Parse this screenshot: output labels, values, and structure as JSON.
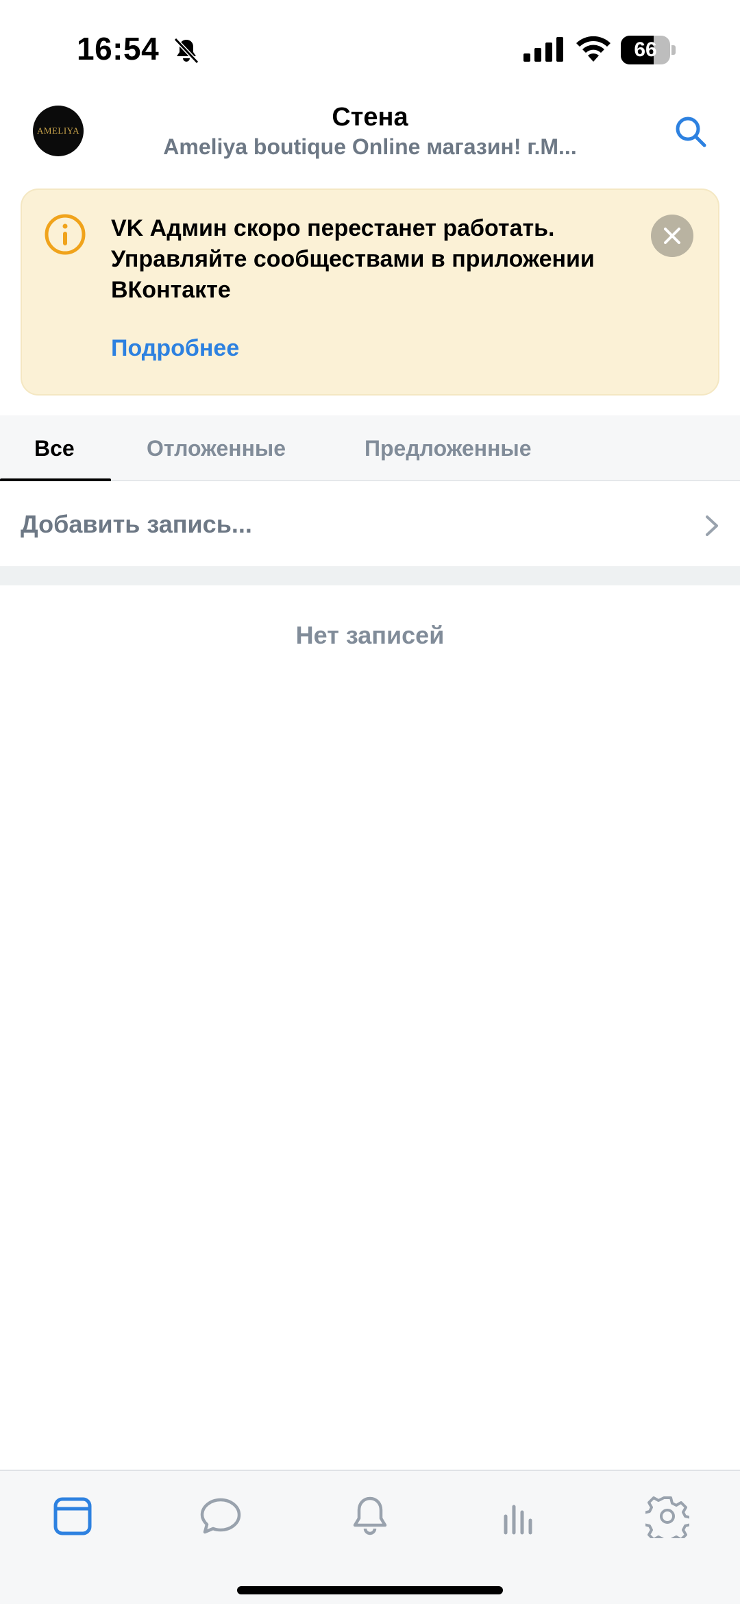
{
  "status_bar": {
    "time": "16:54",
    "battery": "66",
    "battery_level": 0.66
  },
  "header": {
    "title": "Стена",
    "subtitle": "Ameliya boutique Online магазин! г.М...",
    "avatar_text": "AMELIYA"
  },
  "banner": {
    "message": "VK Админ скоро перестанет работать. Управляйте сообществами в приложении ВКонтакте",
    "link": "Подробнее",
    "background": "#fbf1d6",
    "accent": "#f0a31b",
    "link_color": "#2d81e0"
  },
  "tabs": [
    {
      "label": "Все",
      "active": true
    },
    {
      "label": "Отложенные",
      "active": false
    },
    {
      "label": "Предложенные",
      "active": false
    }
  ],
  "add_post": {
    "placeholder": "Добавить запись..."
  },
  "empty_state": {
    "text": "Нет записей"
  },
  "tabbar": {
    "items": [
      {
        "icon": "wall-icon",
        "active": true
      },
      {
        "icon": "messages-icon",
        "active": false
      },
      {
        "icon": "notifications-icon",
        "active": false
      },
      {
        "icon": "statistics-icon",
        "active": false
      },
      {
        "icon": "settings-icon",
        "active": false
      }
    ],
    "active_color": "#2d81e0",
    "inactive_color": "#99a2ad"
  }
}
